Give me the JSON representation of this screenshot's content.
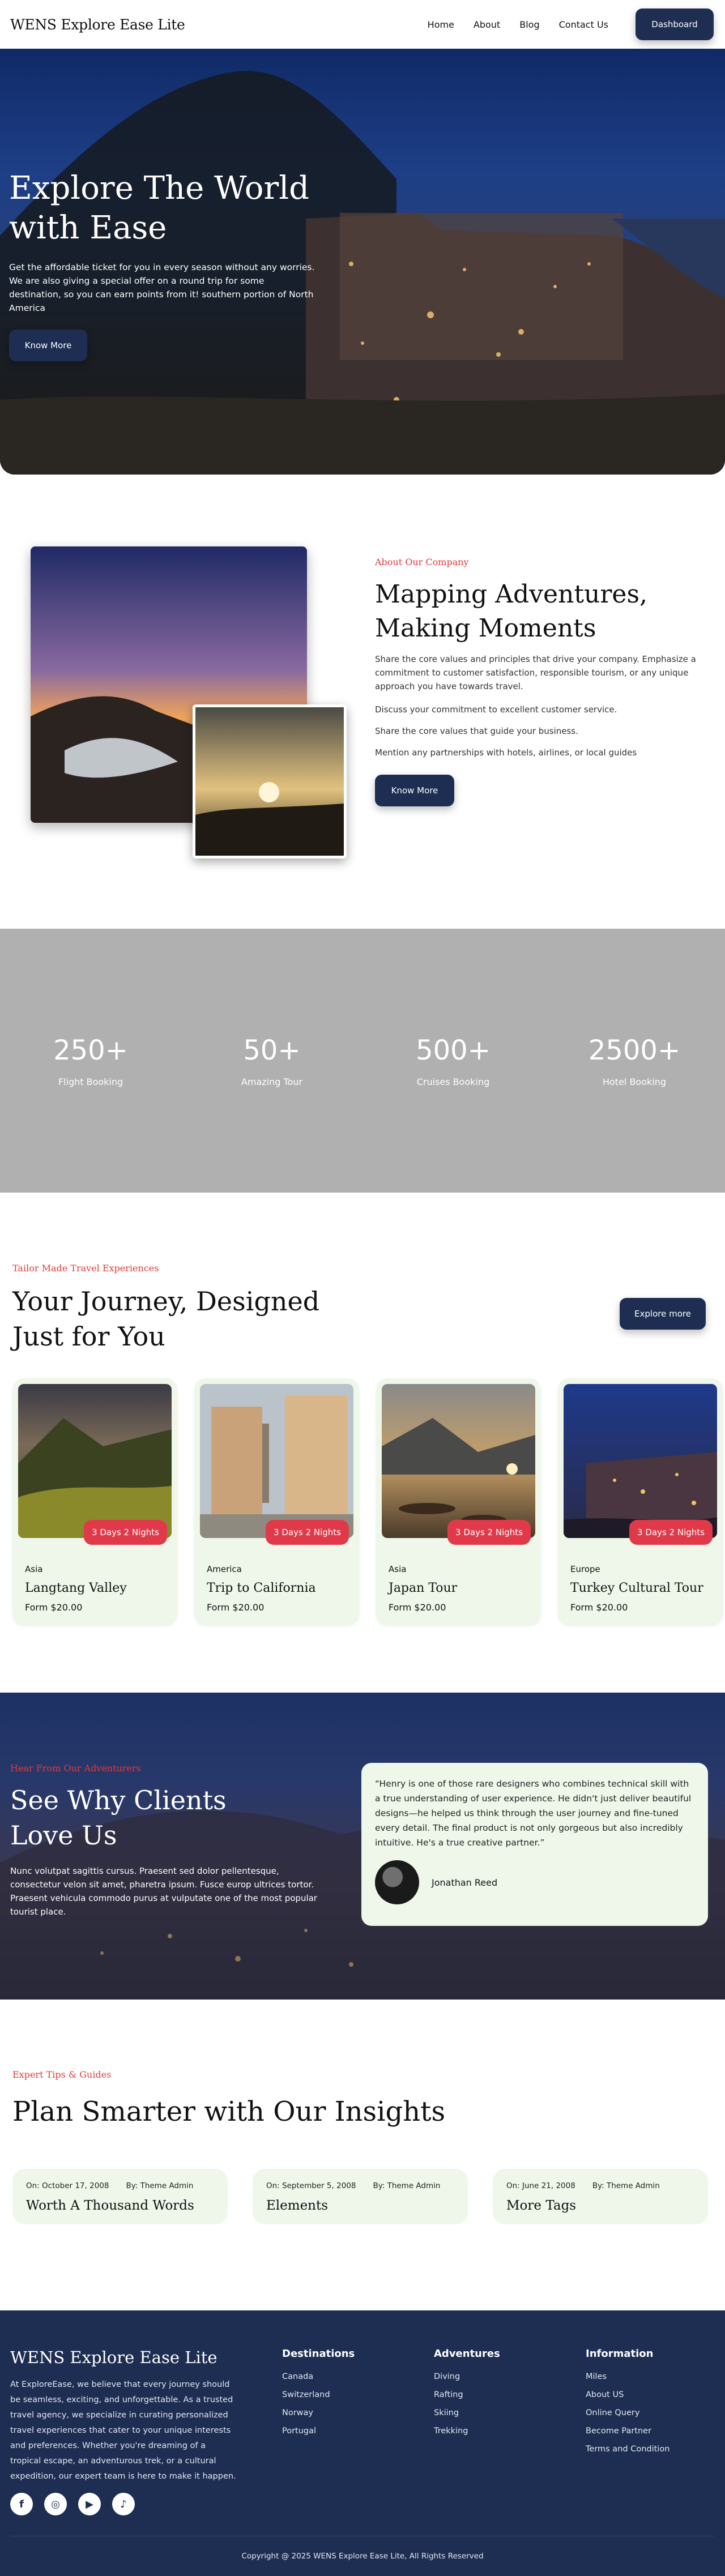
{
  "header": {
    "logo": "WENS Explore Ease Lite",
    "nav": [
      "Home",
      "About",
      "Blog",
      "Contact Us"
    ],
    "dashboard_label": "Dashboard"
  },
  "hero": {
    "title_line1": "Explore The World",
    "title_line2": "with Ease",
    "text": "Get the affordable ticket for you in every season without any worries. We are also giving a special offer on a round trip for some destination, so you can earn points from it! southern portion of North America",
    "button": "Know More"
  },
  "about": {
    "eyebrow": "About Our Company",
    "title": "Mapping Adventures, Making Moments",
    "paragraph": "Share the core values and principles that drive your company. Emphasize a commitment to customer satisfaction, responsible tourism, or any unique approach you have towards travel.",
    "line1": "Discuss your commitment to excellent customer service.",
    "line2": "Share the core values that guide your business.",
    "line3": "Mention any partnerships with hotels, airlines, or local guides",
    "button": "Know More"
  },
  "stats": [
    {
      "value": "250+",
      "label": "Flight Booking"
    },
    {
      "value": "50+",
      "label": "Amazing Tour"
    },
    {
      "value": "500+",
      "label": "Cruises Booking"
    },
    {
      "value": "2500+",
      "label": "Hotel Booking"
    }
  ],
  "tours": {
    "eyebrow": "Tailor Made Travel Experiences",
    "title": "Your Journey, Designed Just for You",
    "button": "Explore more",
    "cards": [
      {
        "region": "Asia",
        "title": "Langtang Valley",
        "price": "Form $20.00",
        "badge": "3 Days 2 Nights"
      },
      {
        "region": "America",
        "title": "Trip to California",
        "price": "Form $20.00",
        "badge": "3 Days 2 Nights"
      },
      {
        "region": "Asia",
        "title": "Japan Tour",
        "price": "Form $20.00",
        "badge": "3 Days 2 Nights"
      },
      {
        "region": "Europe",
        "title": "Turkey Cultural Tour",
        "price": "Form $20.00",
        "badge": "3 Days 2 Nights"
      }
    ]
  },
  "testimonials": {
    "eyebrow": "Hear From Our Adventurers",
    "title_line1": "See Why Clients",
    "title_line2": "Love Us",
    "text": "Nunc volutpat sagittis cursus. Praesent sed dolor pellentesque, consectetur velon sit amet, pharetra ipsum. Fusce europ ultrices tortor. Praesent vehicula commodo purus at vulputate one of the most popular tourist place.",
    "quote": "“Henry is one of those rare designers who combines technical skill with a true understanding of user experience. He didn't just deliver beautiful designs—he helped us think through the user journey and fine-tuned every detail. The final product is not only gorgeous but also incredibly intuitive. He's a true creative partner.”",
    "author": "Jonathan Reed"
  },
  "insights": {
    "eyebrow": "Expert Tips & Guides",
    "title": "Plan Smarter with Our Insights",
    "posts": [
      {
        "date": "On:  October 17, 2008",
        "by": "By:  Theme Admin",
        "title": "Worth A Thousand Words"
      },
      {
        "date": "On:  September 5, 2008",
        "by": "By:  Theme Admin",
        "title": "Elements"
      },
      {
        "date": "On:  June 21, 2008",
        "by": "By:  Theme Admin",
        "title": "More Tags"
      }
    ]
  },
  "footer": {
    "logo": "WENS Explore Ease Lite",
    "about": "At ExploreEase, we believe that every journey should be seamless, exciting, and unforgettable. As a trusted travel agency, we specialize in curating personalized travel experiences that cater to your unique interests and preferences. Whether you're dreaming of a tropical escape, an adventurous trek, or a cultural expedition, our expert team is here to make it happen.",
    "columns": [
      {
        "title": "Destinations",
        "items": [
          "Canada",
          "Switzerland",
          "Norway",
          "Portugal"
        ]
      },
      {
        "title": "Adventures",
        "items": [
          "Diving",
          "Rafting",
          "Skiing",
          "Trekking"
        ]
      },
      {
        "title": "Information",
        "items": [
          "Miles",
          "About US",
          "Online Query",
          "Become Partner",
          "Terms and Condition"
        ]
      }
    ],
    "copyright": "Copyright @ 2025 WENS Explore Ease Lite, All Rights Reserved",
    "social_icons": [
      "facebook-icon",
      "instagram-icon",
      "youtube-icon",
      "tiktok-icon"
    ]
  },
  "colors": {
    "navy": "#1d2e52",
    "accent_red": "#e03a3e",
    "card_bg": "#eef7ea",
    "stats_bg": "#b0b0b0"
  }
}
